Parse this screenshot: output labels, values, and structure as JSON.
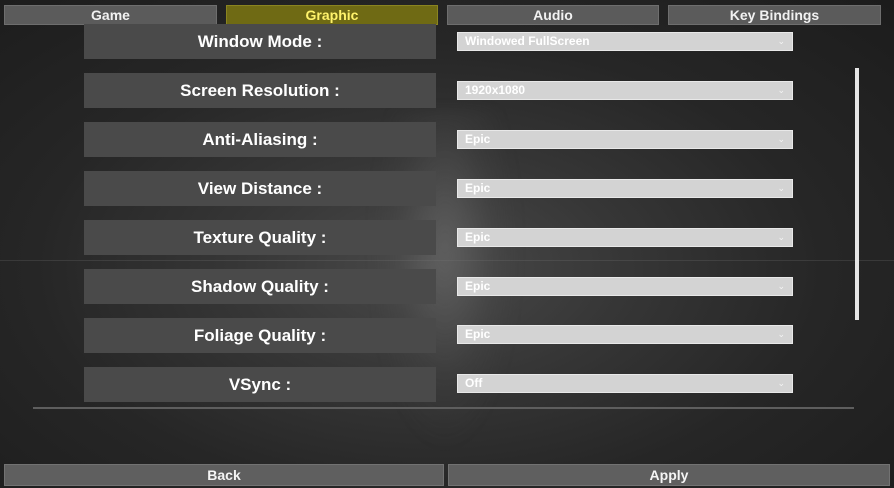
{
  "tabs": [
    {
      "label": "Game",
      "active": false
    },
    {
      "label": "Graphic",
      "active": true
    },
    {
      "label": "Audio",
      "active": false
    },
    {
      "label": "Key Bindings",
      "active": false
    }
  ],
  "settings": [
    {
      "label": "Window Mode :",
      "value": "Windowed FullScreen"
    },
    {
      "label": "Screen Resolution :",
      "value": "1920x1080"
    },
    {
      "label": "Anti-Aliasing :",
      "value": "Epic"
    },
    {
      "label": "View Distance :",
      "value": "Epic"
    },
    {
      "label": "Texture Quality :",
      "value": "Epic"
    },
    {
      "label": "Shadow Quality :",
      "value": "Epic"
    },
    {
      "label": "Foliage Quality :",
      "value": "Epic"
    },
    {
      "label": "VSync :",
      "value": "Off"
    }
  ],
  "dropdown_caret": "⌄",
  "footer": {
    "back_label": "Back",
    "apply_label": "Apply"
  },
  "colors": {
    "active_tab": "#6f6a14",
    "active_tab_text": "#fff36b",
    "panel": "#4a4a4a",
    "select": "#d3d3d3"
  }
}
